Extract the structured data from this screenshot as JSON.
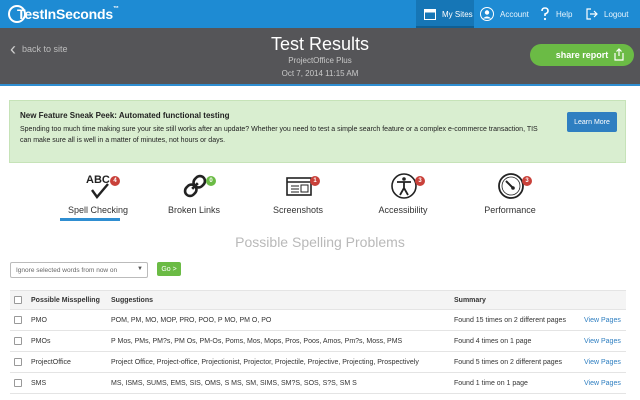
{
  "nav": {
    "logo": "TestInSeconds",
    "logo_tm": "™",
    "items": [
      {
        "label": "My Sites",
        "icon": "sites-icon"
      },
      {
        "label": "Account",
        "icon": "user-icon"
      },
      {
        "label": "Help",
        "icon": "help-icon"
      },
      {
        "label": "Logout",
        "icon": "logout-icon"
      }
    ]
  },
  "header": {
    "back_label": "back to site",
    "title": "Test Results",
    "site": "ProjectOffice Plus",
    "date": "Oct 7, 2014 11:15 AM",
    "share_label": "share report"
  },
  "banner": {
    "title": "New Feature Sneak Peek: Automated functional testing",
    "text": "Spending too much time making sure your site still works after an update? Whether you need to test a simple search feature or a complex e-commerce transaction, TIS can make sure all is well in a matter of minutes, not hours or days.",
    "button": "Learn More"
  },
  "tabs": [
    {
      "label": "Spell Checking",
      "count": "4",
      "icon": "spellcheck-icon",
      "active": true
    },
    {
      "label": "Broken Links",
      "count": "0",
      "icon": "link-icon",
      "active": false
    },
    {
      "label": "Screenshots",
      "count": "1",
      "icon": "browser-icon",
      "active": false
    },
    {
      "label": "Accessibility",
      "count": "3",
      "icon": "accessibility-icon",
      "active": false
    },
    {
      "label": "Performance",
      "count": "3",
      "icon": "gauge-icon",
      "active": false
    }
  ],
  "section_title": "Possible Spelling Problems",
  "controls": {
    "select_value": "Ignore selected words from now on",
    "go_label": "Go >"
  },
  "table": {
    "headers": {
      "word": "Possible Misspelling",
      "suggestions": "Suggestions",
      "summary": "Summary"
    },
    "rows": [
      {
        "word": "PMO",
        "suggestions": "POM, PM, MO, MOP, PRO, POO, P MO, PM O, PO",
        "summary": "Found 15 times on 2 different pages",
        "link": "View Pages"
      },
      {
        "word": "PMOs",
        "suggestions": "P Mos, PMs, PM?s, PM Os, PM-Os, Poms, Mos, Mops, Pros, Poos, Amos, Pm?s, Moss, PMS",
        "summary": "Found 4 times on 1 page",
        "link": "View Pages"
      },
      {
        "word": "ProjectOffice",
        "suggestions": "Project Office, Project-office, Projectionist, Projector, Projectile, Projective, Projecting, Prospectively",
        "summary": "Found 5 times on 2 different pages",
        "link": "View Pages"
      },
      {
        "word": "SMS",
        "suggestions": "MS, ISMS, SUMS, EMS, SIS, OMS, S MS, SM, SIMS, SM?S, SOS, S?S, SM S",
        "summary": "Found 1 time on 1 page",
        "link": "View Pages"
      }
    ]
  },
  "colors": {
    "nav_blue": "#1e8bd3",
    "header_gray": "#555558",
    "green": "#6bbb45",
    "badge_red": "#c9413a",
    "link_blue": "#2f7fc1"
  }
}
